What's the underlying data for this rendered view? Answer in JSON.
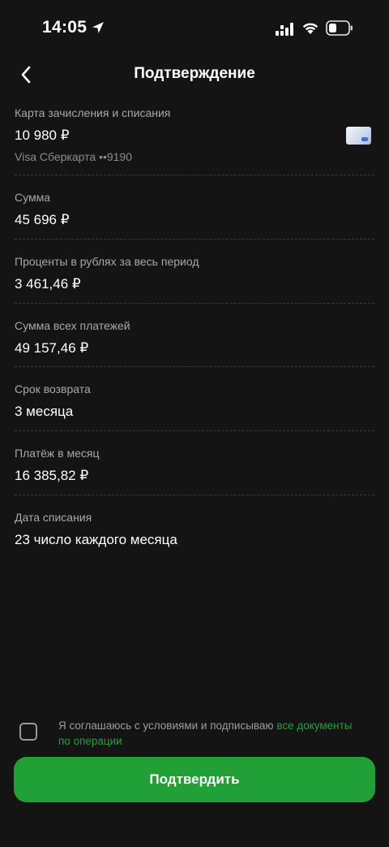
{
  "status_bar": {
    "time": "14:05"
  },
  "header": {
    "title": "Подтверждение"
  },
  "details": {
    "card": {
      "label": "Карта зачисления и списания",
      "balance": "10 980 ₽",
      "card_name": "Visa Сберкарта ••9190"
    },
    "amount": {
      "label": "Сумма",
      "value": "45 696 ₽"
    },
    "interest": {
      "label": "Проценты в рублях за весь период",
      "value": "3 461,46 ₽"
    },
    "total": {
      "label": "Сумма всех платежей",
      "value": "49 157,46 ₽"
    },
    "term": {
      "label": "Срок возврата",
      "value": "3 месяца"
    },
    "monthly": {
      "label": "Платёж в месяц",
      "value": "16 385,82 ₽"
    },
    "debit_date": {
      "label": "Дата списания",
      "value": "23 число каждого месяца"
    }
  },
  "agreement": {
    "text": "Я соглашаюсь с условиями и подписываю ",
    "link": "все документы по операции",
    "checked": false
  },
  "confirm_button": {
    "label": "Подтвердить"
  },
  "colors": {
    "background": "#141414",
    "accent": "#21a038",
    "secondary_text": "#a8a8a8"
  },
  "icons": {
    "back": "chevron-left-icon",
    "location": "location-arrow-icon",
    "signal": "signal-icon",
    "wifi": "wifi-icon",
    "battery": "battery-icon"
  }
}
